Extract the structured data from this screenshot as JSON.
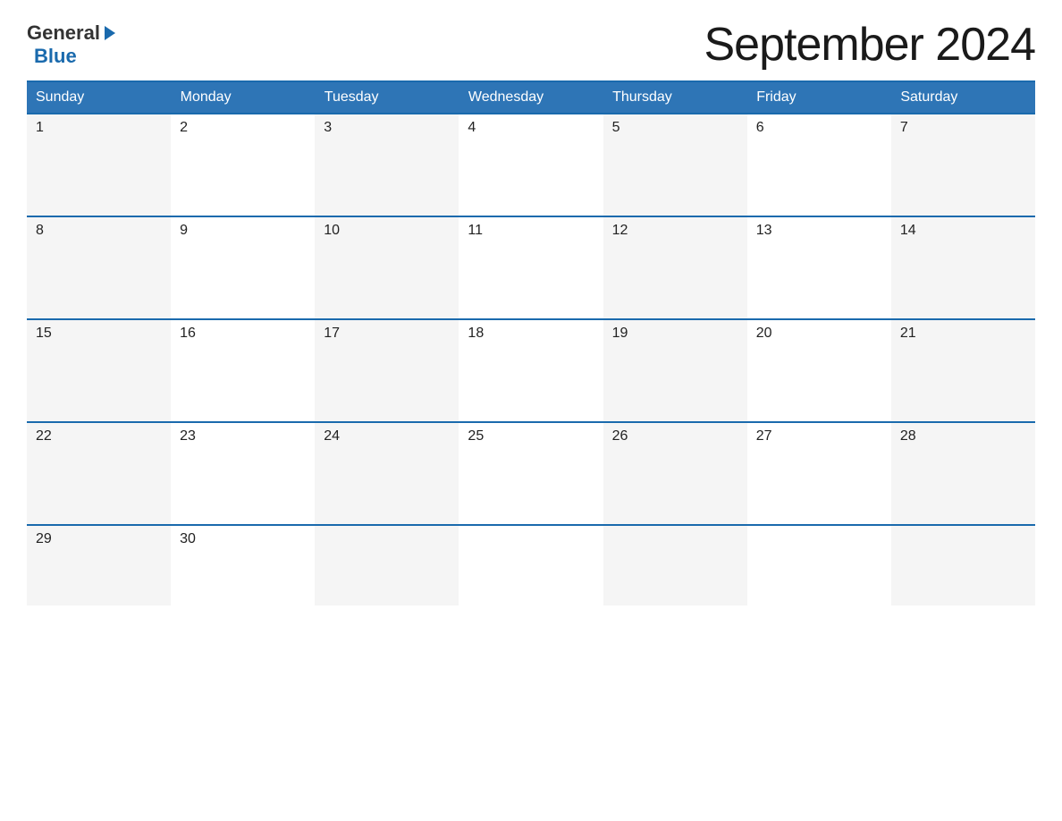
{
  "logo": {
    "general": "General",
    "blue": "Blue"
  },
  "title": "September 2024",
  "calendar": {
    "headers": [
      "Sunday",
      "Monday",
      "Tuesday",
      "Wednesday",
      "Thursday",
      "Friday",
      "Saturday"
    ],
    "weeks": [
      [
        {
          "day": "1"
        },
        {
          "day": "2"
        },
        {
          "day": "3"
        },
        {
          "day": "4"
        },
        {
          "day": "5"
        },
        {
          "day": "6"
        },
        {
          "day": "7"
        }
      ],
      [
        {
          "day": "8"
        },
        {
          "day": "9"
        },
        {
          "day": "10"
        },
        {
          "day": "11"
        },
        {
          "day": "12"
        },
        {
          "day": "13"
        },
        {
          "day": "14"
        }
      ],
      [
        {
          "day": "15"
        },
        {
          "day": "16"
        },
        {
          "day": "17"
        },
        {
          "day": "18"
        },
        {
          "day": "19"
        },
        {
          "day": "20"
        },
        {
          "day": "21"
        }
      ],
      [
        {
          "day": "22"
        },
        {
          "day": "23"
        },
        {
          "day": "24"
        },
        {
          "day": "25"
        },
        {
          "day": "26"
        },
        {
          "day": "27"
        },
        {
          "day": "28"
        }
      ],
      [
        {
          "day": "29"
        },
        {
          "day": "30"
        },
        {
          "day": ""
        },
        {
          "day": ""
        },
        {
          "day": ""
        },
        {
          "day": ""
        },
        {
          "day": ""
        }
      ]
    ]
  }
}
